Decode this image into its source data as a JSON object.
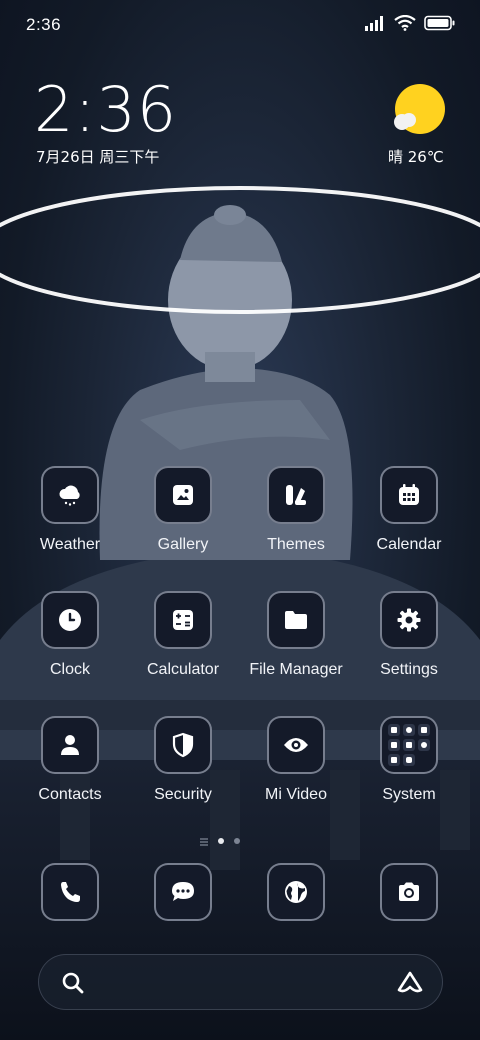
{
  "status_bar": {
    "time": "2:36"
  },
  "clock_widget": {
    "time": "2:36",
    "date": "7月26日 周三下午"
  },
  "weather_widget": {
    "condition_temp": "晴 26℃",
    "icon": "sunny-cloud-icon"
  },
  "apps": [
    {
      "label": "Weather",
      "icon": "weather-icon"
    },
    {
      "label": "Gallery",
      "icon": "gallery-icon"
    },
    {
      "label": "Themes",
      "icon": "themes-icon"
    },
    {
      "label": "Calendar",
      "icon": "calendar-icon"
    },
    {
      "label": "Clock",
      "icon": "clock-icon"
    },
    {
      "label": "Calculator",
      "icon": "calculator-icon"
    },
    {
      "label": "File Manager",
      "icon": "folder-icon"
    },
    {
      "label": "Settings",
      "icon": "gear-icon"
    },
    {
      "label": "Contacts",
      "icon": "contacts-icon"
    },
    {
      "label": "Security",
      "icon": "shield-icon"
    },
    {
      "label": "Mi Video",
      "icon": "eye-icon"
    },
    {
      "label": "System",
      "icon": "folder-grid-icon"
    }
  ],
  "dock": [
    {
      "icon": "phone-icon"
    },
    {
      "icon": "message-icon"
    },
    {
      "icon": "browser-icon"
    },
    {
      "icon": "camera-icon"
    }
  ],
  "page_indicator": {
    "pages": 2,
    "active": 1
  },
  "colors": {
    "sun": "#ffd21f",
    "tile_bg": "#141a29",
    "halo": "#ffffff"
  }
}
